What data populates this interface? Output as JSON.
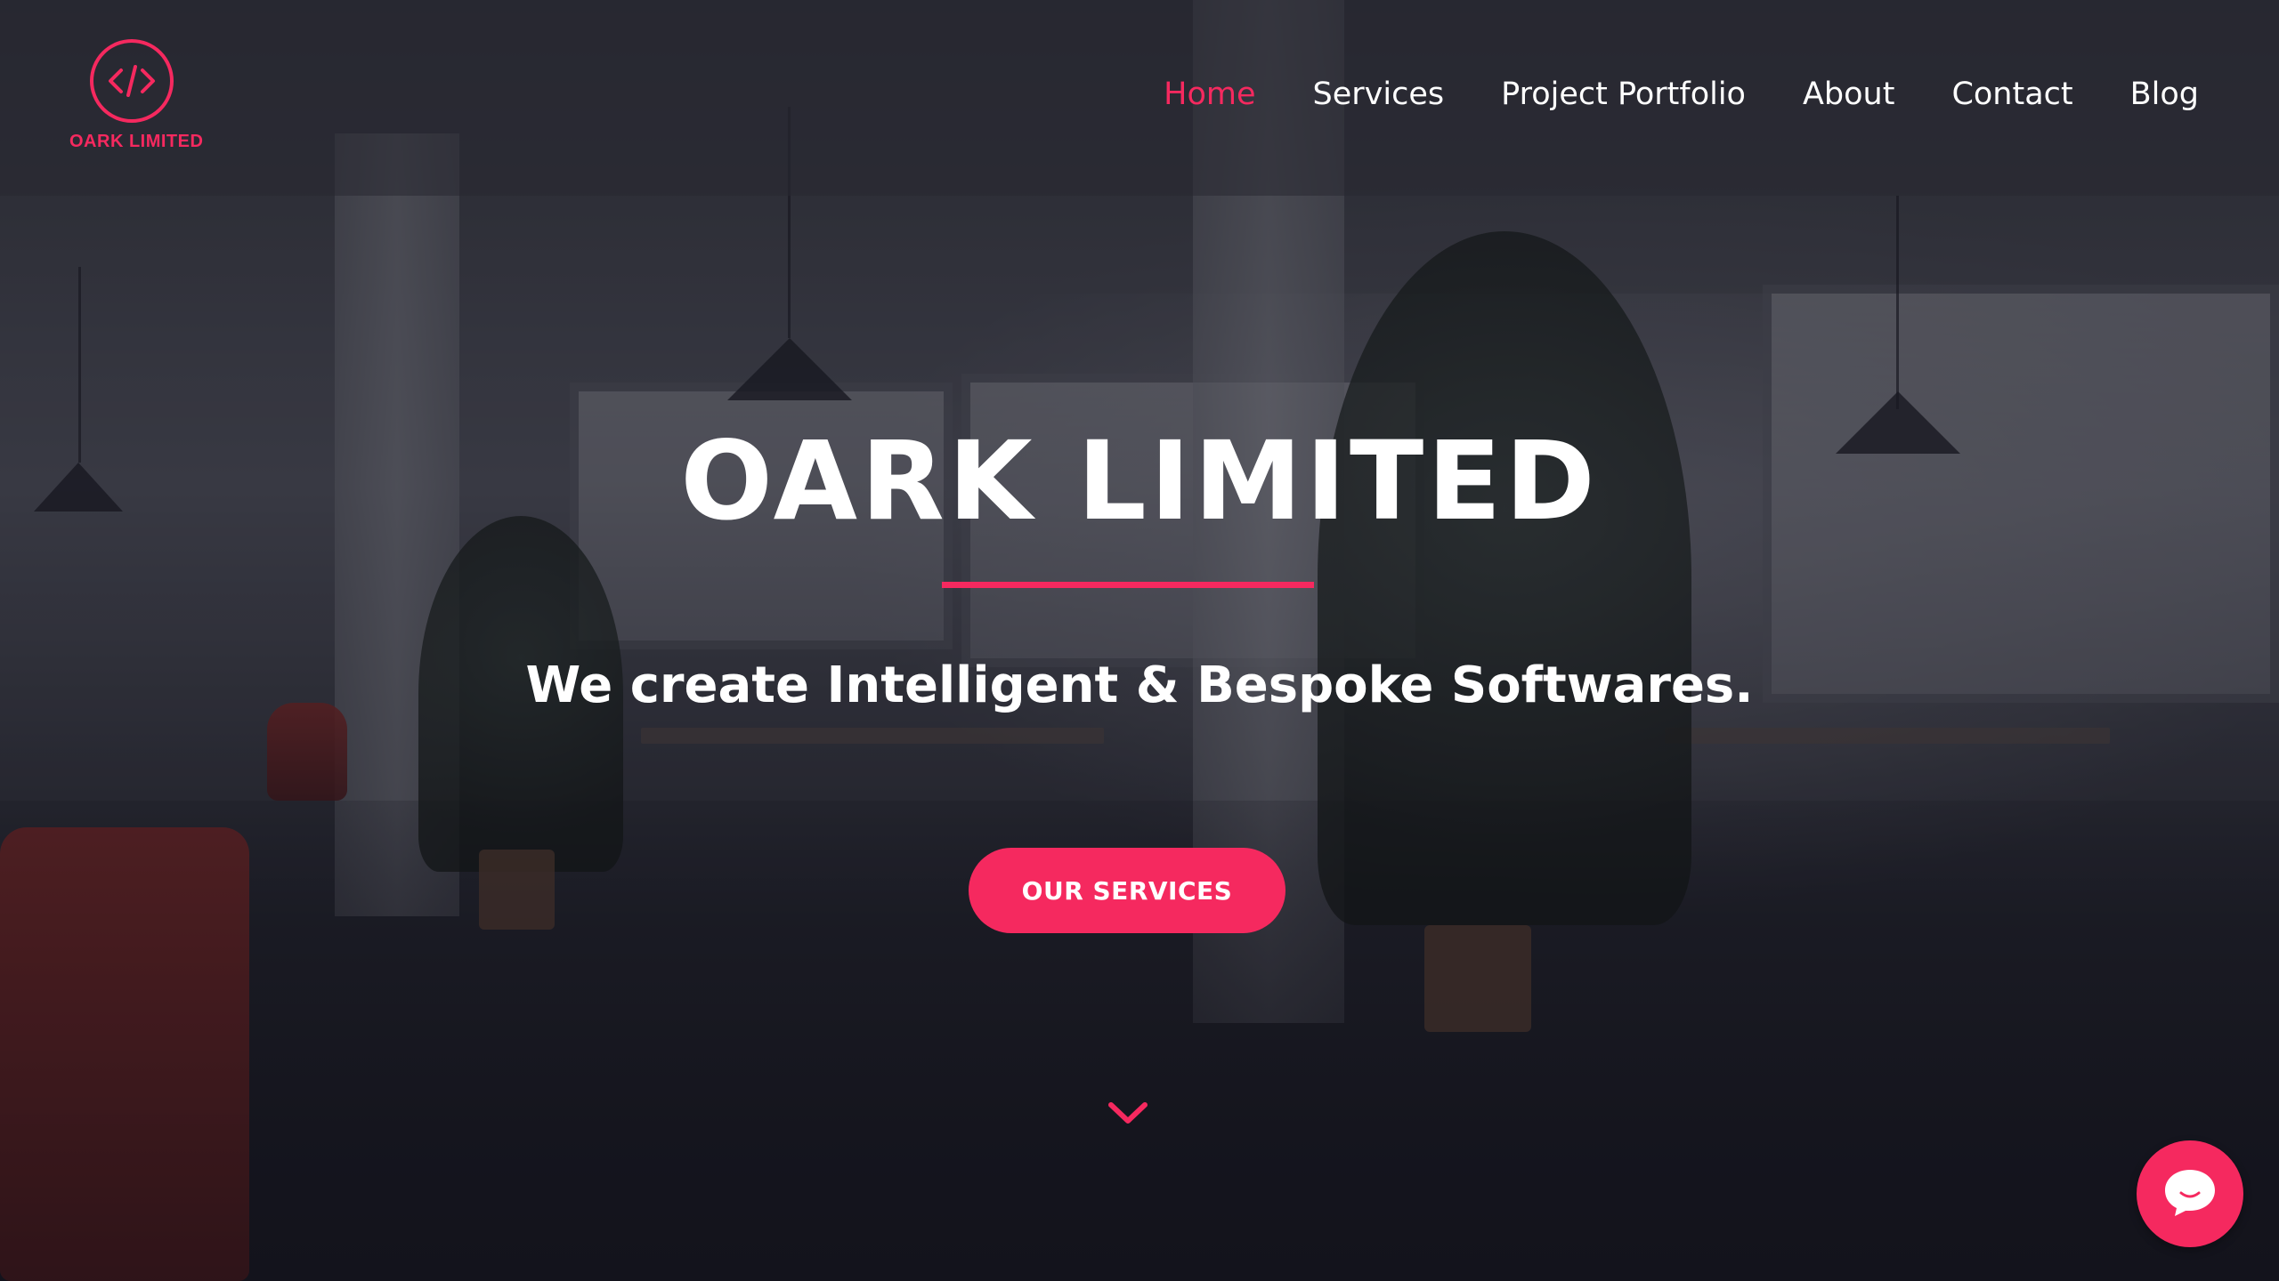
{
  "brand": {
    "name": "OARK LIMITED",
    "logo_icon": "code-brackets-icon",
    "accent_color": "#f5295f"
  },
  "nav": {
    "items": [
      {
        "label": "Home",
        "active": true
      },
      {
        "label": "Services",
        "active": false
      },
      {
        "label": "Project Portfolio",
        "active": false
      },
      {
        "label": "About",
        "active": false
      },
      {
        "label": "Contact",
        "active": false
      },
      {
        "label": "Blog",
        "active": false
      }
    ]
  },
  "hero": {
    "title": "OARK LIMITED",
    "subtitle": "We create Intelligent & Bespoke Softwares.",
    "cta_label": "OUR SERVICES",
    "scroll_icon": "chevron-down-icon"
  },
  "chat": {
    "icon": "chat-bubble-icon"
  }
}
